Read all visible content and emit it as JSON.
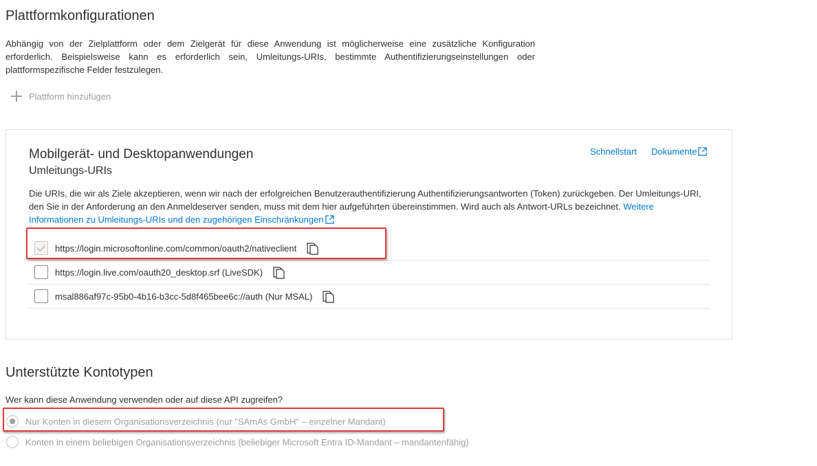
{
  "platform_section": {
    "title": "Plattformkonfigurationen",
    "description": "Abhängig von der Zielplattform oder dem Zielgerät für diese Anwendung ist möglicherweise eine zusätzliche Konfiguration erforderlich. Beispielsweise kann es erforderlich sein, Umleitungs-URIs, bestimmte Authentifizierungseinstellungen oder plattformspezifische Felder festzulegen.",
    "add_platform_label": "Plattform hinzufügen"
  },
  "mobile_card": {
    "title": "Mobilgerät- und Desktopanwendungen",
    "subtitle": "Umleitungs-URIs",
    "quickstart_link": "Schnellstart",
    "docs_link": "Dokumente",
    "description": "Die URIs, die wir als Ziele akzeptieren, wenn wir nach der erfolgreichen Benutzerauthentifizierung Authentifizierungsantworten (Token) zurückgeben. Der Umleitungs-URI, den Sie in der Anforderung an den Anmeldeserver senden, muss mit dem hier aufgeführten übereinstimmen. Wird auch als Antwort-URLs bezeichnet.",
    "more_info_link": "Weitere Informationen zu Umleitungs-URIs und den zugehörigen Einschränkungen",
    "uris": [
      {
        "value": "https://login.microsoftonline.com/common/oauth2/nativeclient",
        "checked": true
      },
      {
        "value": "https://login.live.com/oauth20_desktop.srf (LiveSDK)",
        "checked": false
      },
      {
        "value": "msal886af97c-95b0-4b16-b3cc-5d8f465bee6c://auth (Nur MSAL)",
        "checked": false
      }
    ]
  },
  "account_section": {
    "title": "Unterstützte Kontotypen",
    "question": "Wer kann diese Anwendung verwenden oder auf diese API zugreifen?",
    "options": [
      {
        "label": "Nur Konten in diesem Organisationsverzeichnis (nur \"SAmAs GmbH\" – einzelner Mandant)",
        "selected": true
      },
      {
        "label": "Konten in einem beliebigen Organisationsverzeichnis (beliebiger Microsoft Entra ID-Mandant – mandantenfähig)",
        "selected": false
      }
    ]
  },
  "colors": {
    "accent": "#0078d4",
    "highlight": "#e03c3c",
    "disabled": "#a19f9d"
  }
}
